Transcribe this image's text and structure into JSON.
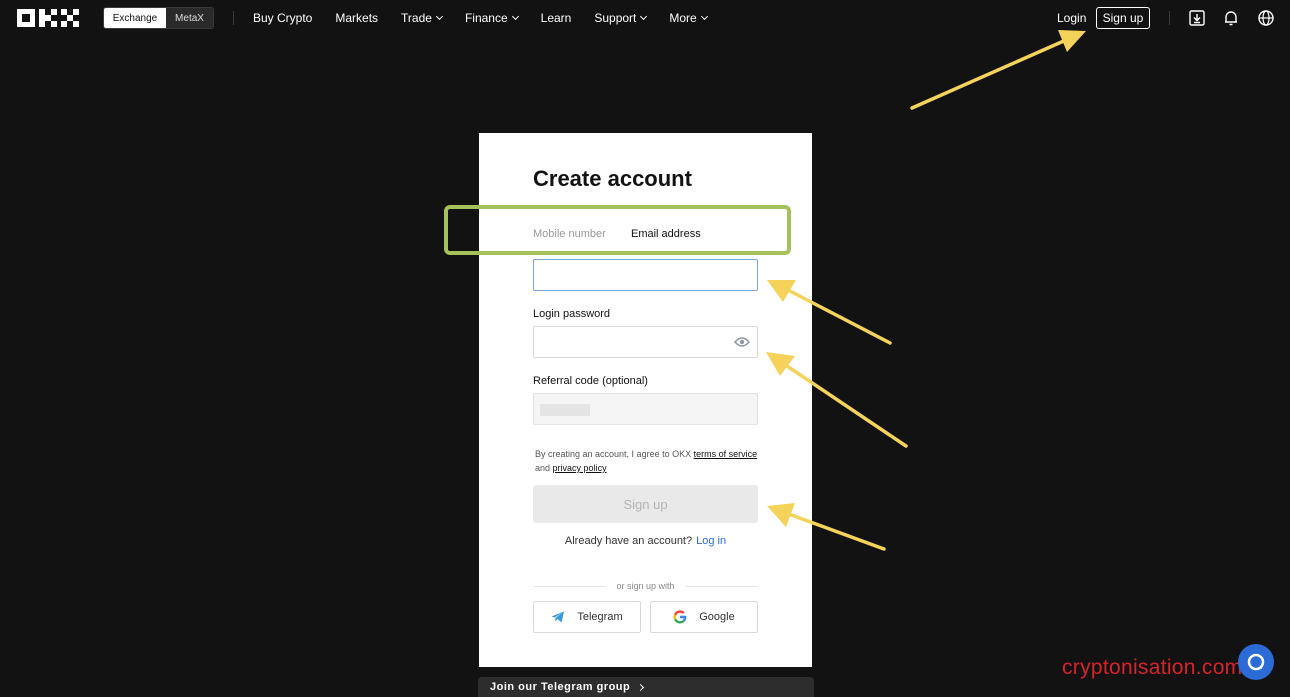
{
  "nav": {
    "logo_text": "OKX",
    "switch": [
      "Exchange",
      "MetaX"
    ],
    "links": [
      {
        "label": "Buy Crypto",
        "dropdown": false
      },
      {
        "label": "Markets",
        "dropdown": false
      },
      {
        "label": "Trade",
        "dropdown": true
      },
      {
        "label": "Finance",
        "dropdown": true
      },
      {
        "label": "Learn",
        "dropdown": false
      },
      {
        "label": "Support",
        "dropdown": true
      },
      {
        "label": "More",
        "dropdown": true
      }
    ],
    "login": "Login",
    "signup": "Sign up",
    "icons": [
      "download-icon",
      "bell-icon",
      "globe-icon"
    ]
  },
  "form": {
    "title": "Create account",
    "tab_mobile": "Mobile number",
    "tab_email": "Email address",
    "email_value": "",
    "password_label": "Login password",
    "password_value": "",
    "referral_label": "Referral code (optional)",
    "terms_prefix": "By creating an account, I agree to OKX",
    "terms_link": "terms of service",
    "terms_and": "and",
    "privacy_link": "privacy policy",
    "signup_button": "Sign up",
    "already_text": "Already have an account?",
    "login_link": "Log in",
    "or_text": "or sign up with",
    "social": [
      "Telegram",
      "Google"
    ]
  },
  "bottom": {
    "telegram_banner": "Join our Telegram group",
    "watermark": "cryptonisation.com"
  },
  "colors": {
    "background": "#121212",
    "highlight_box": "#a5c25a",
    "arrow": "#f5d25a",
    "link_blue": "#2b6bd6",
    "watermark_red": "#d8232a"
  }
}
